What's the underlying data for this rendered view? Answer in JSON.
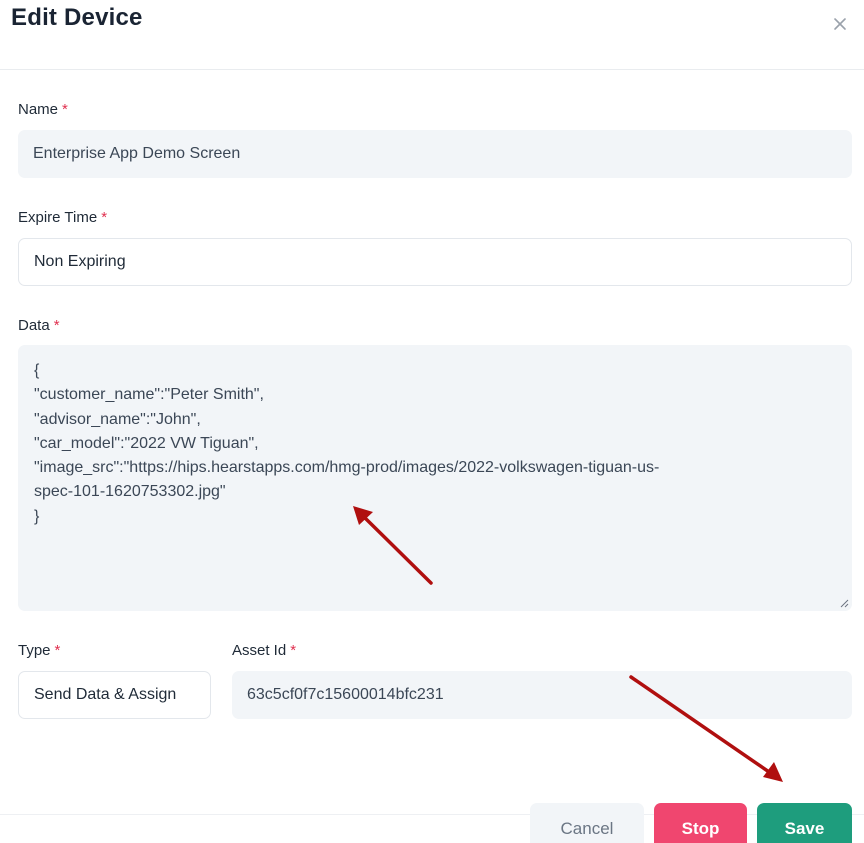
{
  "modal": {
    "title": "Edit Device",
    "close_icon": "close-icon"
  },
  "form": {
    "name": {
      "label": "Name",
      "required": "*",
      "value": "Enterprise App Demo Screen"
    },
    "expire_time": {
      "label": "Expire Time",
      "required": "*",
      "value": "Non Expiring"
    },
    "data": {
      "label": "Data",
      "required": "*",
      "lines": [
        "{",
        "\"customer_name\":\"Peter Smith\",",
        "\"advisor_name\":\"John\",",
        "\"car_model\":\"2022 VW Tiguan\",",
        "\"image_src\":\"https://hips.hearstapps.com/hmg-prod/images/2022-volkswagen-tiguan-us-",
        "spec-101-1620753302.jpg\"",
        "}"
      ]
    },
    "type": {
      "label": "Type",
      "required": "*",
      "value": "Send Data & Assign"
    },
    "asset_id": {
      "label": "Asset Id",
      "required": "*",
      "value": "63c5cf0f7c15600014bfc231"
    }
  },
  "footer": {
    "cancel_label": "Cancel",
    "stop_label": "Stop",
    "save_label": "Save"
  },
  "colors": {
    "accent_save": "#1e9d7d",
    "accent_stop": "#f0466f",
    "required": "#e0304f",
    "annotation_arrow": "#b00f0f"
  }
}
